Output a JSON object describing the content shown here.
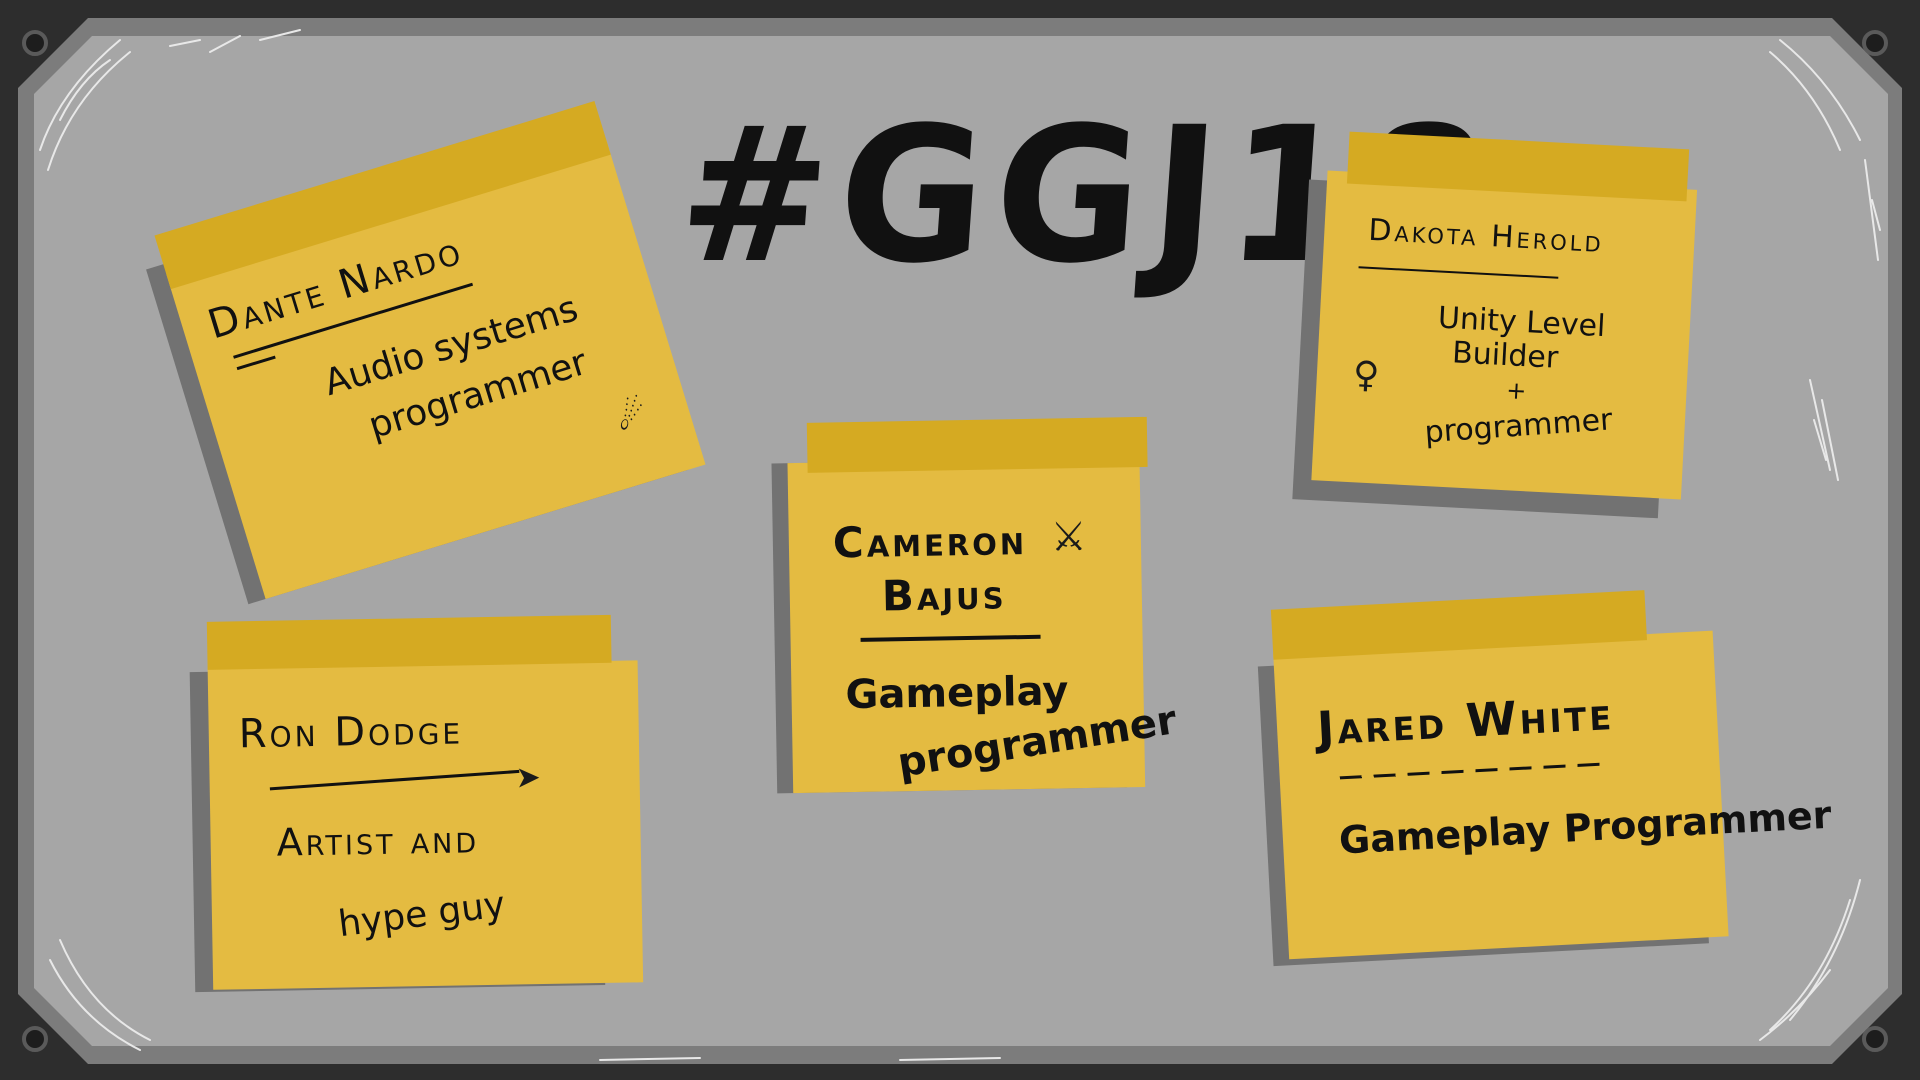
{
  "board": {
    "title": "#GGJ18"
  },
  "notes": [
    {
      "id": "dante",
      "name": "Dante Nardo",
      "role_line1": "Audio systems",
      "role_line2": "programmer",
      "doodle_icon": "alien-doodle-icon"
    },
    {
      "id": "cameron",
      "name_line1": "Cameron",
      "name_line2": "Bajus",
      "role_line1": "Gameplay",
      "role_line2": "programmer",
      "doodle_icon": "gunner-doodle-icon"
    },
    {
      "id": "dakota",
      "name": "Dakota Herold",
      "role_line1": "Unity Level",
      "role_line2": "Builder",
      "role_line3": "+",
      "role_line4": "programmer",
      "doodle_icon": "stick-figure-doodle-icon"
    },
    {
      "id": "ron",
      "name": "Ron Dodge",
      "role_line1": "Artist  and",
      "role_line2": "hype  guy",
      "doodle_icon": "arrow-doodle-icon"
    },
    {
      "id": "jared",
      "name": "Jared White",
      "role_line1": "Gameplay  Programmer"
    }
  ],
  "colors": {
    "frame": "#7c7c7c",
    "board": "#a6a6a6",
    "note": "#e4bb41",
    "note_strip": "#d5aa22",
    "shadow": "#727272",
    "ink": "#111111"
  }
}
